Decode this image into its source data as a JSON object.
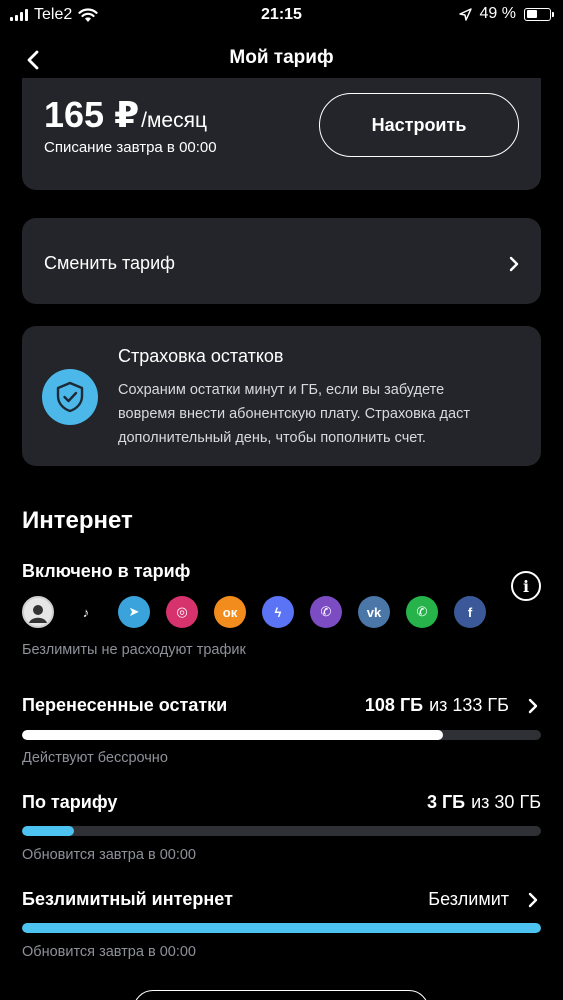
{
  "status_bar": {
    "carrier": "Tele2",
    "time": "21:15",
    "battery": "49 %"
  },
  "header": {
    "title": "Мой тариф"
  },
  "price_card": {
    "amount": "165 ₽",
    "unit": "/месяц",
    "charge_note": "Списание завтра в 00:00",
    "configure_label": "Настроить"
  },
  "change_tariff": {
    "label": "Сменить тариф"
  },
  "insurance": {
    "title": "Страховка остатков",
    "line1": "Сохраним остатки минут и ГБ, если вы забудете",
    "line2": "вовремя внести абонентскую плату. Страховка даст",
    "line3": "дополнительный день, чтобы пополнить счет.",
    "accent": "#4cb8ea"
  },
  "internet": {
    "title": "Интернет",
    "included_title": "Включено в тариф",
    "apps": [
      {
        "name": "avatar",
        "bg": "#e6e6e6",
        "glyph": ""
      },
      {
        "name": "tiktok",
        "bg": "#000000",
        "glyph": "♪"
      },
      {
        "name": "telegram",
        "bg": "#3aa3dc",
        "glyph": "➤"
      },
      {
        "name": "instagram",
        "bg": "#d6336c",
        "glyph": "◎"
      },
      {
        "name": "odnoklassniki",
        "bg": "#f28c1d",
        "glyph": "ок"
      },
      {
        "name": "messenger",
        "bg": "#5b73f5",
        "glyph": "ϟ"
      },
      {
        "name": "viber",
        "bg": "#7b4cc2",
        "glyph": "✆"
      },
      {
        "name": "vk",
        "bg": "#4a76a8",
        "glyph": "vk"
      },
      {
        "name": "whatsapp",
        "bg": "#25b34a",
        "glyph": "✆"
      },
      {
        "name": "facebook",
        "bg": "#3b5998",
        "glyph": "f"
      }
    ],
    "unlim_note": "Безлимиты не расходуют трафик",
    "carried": {
      "label": "Перенесенные остатки",
      "amount": "108 ГБ",
      "of": "из 133 ГБ",
      "fraction": 0.812,
      "color": "#ffffff",
      "sub": "Действуют бессрочно"
    },
    "tariff": {
      "label": "По тарифу",
      "amount": "3 ГБ",
      "of": "из 30 ГБ",
      "fraction": 0.1,
      "color": "#4cc3f0",
      "sub": "Обновится завтра в 00:00"
    },
    "unlimited": {
      "label": "Безлимитный интернет",
      "value": "Безлимит",
      "fraction": 1,
      "color": "#4cc3f0",
      "sub": "Обновится завтра в 00:00"
    }
  }
}
